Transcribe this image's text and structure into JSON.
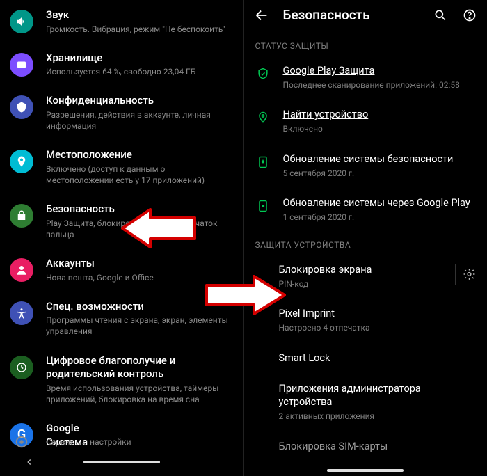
{
  "left": {
    "items": [
      {
        "title": "Звук",
        "sub": "Громкость. Вибрация, режим \"Не беспокоить\"",
        "icon": "sound-icon",
        "color": "#009688"
      },
      {
        "title": "Хранилище",
        "sub": "Используется 64 %, свободно 23,04 ГБ",
        "icon": "storage-icon",
        "color": "#7c4dff"
      },
      {
        "title": "Конфиденциальность",
        "sub": "Разрешения, действия в аккаунте, личная информация",
        "icon": "privacy-icon",
        "color": "#3f51b5"
      },
      {
        "title": "Местоположение",
        "sub": "Включено (доступ к данным о местоположении есть у 17 приложений)",
        "icon": "location-icon",
        "color": "#00bcd4"
      },
      {
        "title": "Безопасность",
        "sub": "Play Защита, блокировка экрана, отпечаток пальца",
        "icon": "security-icon",
        "color": "#2e7d32"
      },
      {
        "title": "Аккаунты",
        "sub": "Нова пошта, Google и Office",
        "icon": "accounts-icon",
        "color": "#e91e63"
      },
      {
        "title": "Спец. возможности",
        "sub": "Программы чтения с экрана, экран, элементы управления",
        "icon": "accessibility-icon",
        "color": "#3f51b5"
      },
      {
        "title": "Цифровое благополучие и родительский контроль",
        "sub": "Время использования устройства, таймеры приложений, блокировка на время сна",
        "icon": "wellbeing-icon",
        "color": "#1b5e20"
      },
      {
        "title": "Google",
        "sub": "Сервисы и настройки",
        "icon": "google-icon",
        "color": "#1a73e8"
      }
    ],
    "system_label": "Система"
  },
  "right": {
    "header_title": "Безопасность",
    "section_status": "СТАТУС ЗАЩИТЫ",
    "status_items": [
      {
        "title": "Google Play Защита",
        "sub": "Последнее сканирование приложений: 02:58",
        "icon": "shield-icon",
        "underline": true
      },
      {
        "title": "Найти устройство",
        "sub": "Включено",
        "icon": "pin-icon",
        "underline": true
      },
      {
        "title": "Обновление системы безопасности",
        "sub": "5 сентября 2020 г.",
        "icon": "update-icon",
        "underline": false
      },
      {
        "title": "Обновление системы через Google Play",
        "sub": "1 сентября 2020 г.",
        "icon": "play-update-icon",
        "underline": false
      }
    ],
    "section_device": "ЗАЩИТА УСТРОЙСТВА",
    "device_items": [
      {
        "title": "Блокировка экрана",
        "sub": "PIN-код",
        "gear": true
      },
      {
        "title": "Pixel Imprint",
        "sub": "Настроено 4 отпечатка",
        "gear": false
      },
      {
        "title": "Smart Lock",
        "sub": "",
        "gear": false
      },
      {
        "title": "Приложения администратора устройства",
        "sub": "2 активных приложения",
        "gear": false
      },
      {
        "title": "Блокировка SIM-карты",
        "sub": "",
        "gear": false
      }
    ]
  }
}
